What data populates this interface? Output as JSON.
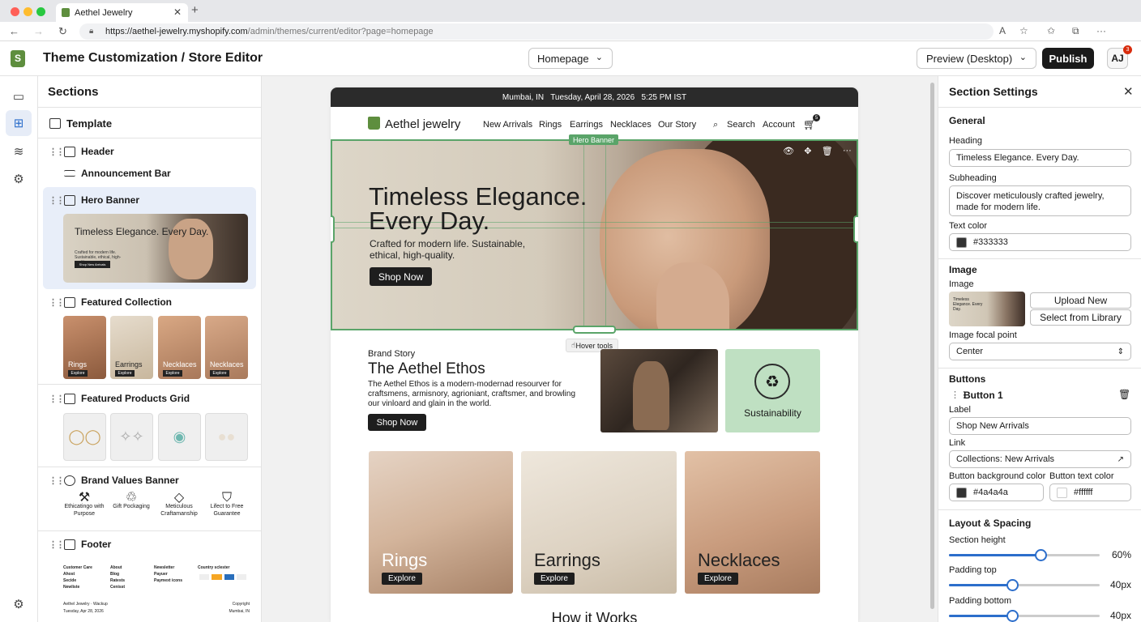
{
  "browser": {
    "tab_title": "Aethel Jewelry",
    "url_host": "https://aethel-jewelry.myshopify.com",
    "url_path": "/admin/themes/current/editor?page=homepage"
  },
  "app": {
    "title": "Theme Customization / Store Editor",
    "page_select": "Homepage",
    "preview_label": "Preview (Desktop)",
    "publish_label": "Publish",
    "avatar": "AJ",
    "notification_count": "3"
  },
  "sections_panel": {
    "heading": "Sections",
    "template_label": "Template",
    "items": [
      {
        "label": "Header"
      },
      {
        "label": "Announcement Bar"
      },
      {
        "label": "Hero Banner"
      },
      {
        "label": "Featured Collection"
      },
      {
        "label": "Featured Products Grid"
      },
      {
        "label": "Brand Values Banner"
      },
      {
        "label": "Footer"
      }
    ],
    "hero_thumb": {
      "title": "Timeless Elegance. Every Day.",
      "sub": "Crafted for modern life. Sustainable, ethical, high-quality.",
      "button": "Shop New Arrivals"
    },
    "featured_collection": [
      {
        "label": "Rings",
        "sub": "Explore"
      },
      {
        "label": "Earrings",
        "sub": "Explore"
      },
      {
        "label": "Necklaces",
        "sub": "Explore"
      },
      {
        "label": "Necklaces",
        "sub": "Explore"
      }
    ],
    "brand_values": [
      {
        "label": "Ethicatingo with Purpose"
      },
      {
        "label": "Gift Pockaging"
      },
      {
        "label": "Meticulous Craftamanship"
      },
      {
        "label": "Lifect to Free Guarantee"
      }
    ],
    "footer_mini": {
      "col1": [
        "Customer Care",
        "Ahost",
        "Secide",
        "Newliste"
      ],
      "col2": [
        "About",
        "Blog",
        "Ratests",
        "Cenisst"
      ],
      "col3": [
        "Newsletter",
        "Payuer",
        "Paymext icons"
      ],
      "country": "Country sclester",
      "bottom_left": "Aethel Jewelry · Wackup",
      "bottom_left_date": "Tuesday, Apr 28, 2026",
      "bottom_right": "Copyright",
      "bottom_right_loc": "Mumbai, IN"
    }
  },
  "store": {
    "topbar": "Mumbai, IN   Tuesday, April 28, 2026   5:25 PM IST",
    "logo": "Aethel jewelry",
    "nav": [
      "New Arrivals",
      "Rings",
      "Earrings",
      "Necklaces",
      "Our Story"
    ],
    "search": "Search",
    "account": "Account",
    "cart_count": "5",
    "hero_tag": "Hero Banner",
    "hero": {
      "heading": "Timeless Elegance. Every Day.",
      "sub": "Crafted for modern life. Sustainable, ethical, high-quality.",
      "button": "Shop Now"
    },
    "hover_tools": "Hover tools",
    "brand": {
      "kicker": "Brand Story",
      "title": "The Aethel Ethos",
      "body": "The Aethel Ethos is a modern-modernad resourver for craftsmens, armisnory, agrioniant, craftsmer, and browling our vinloard and glain in the world.",
      "button": "Shop Now",
      "sustain": "Sustainability"
    },
    "categories": [
      {
        "name": "Rings",
        "cta": "Explore"
      },
      {
        "name": "Earrings",
        "cta": "Explore"
      },
      {
        "name": "Necklaces",
        "cta": "Explore"
      }
    ],
    "how": "How it Works"
  },
  "settings": {
    "heading": "Section Settings",
    "general": "General",
    "heading_label": "Heading",
    "heading_value": "Timeless Elegance. Every Day.",
    "subheading_label": "Subheading",
    "subheading_value": "Discover meticulously crafted jewelry, made for modern life.",
    "text_color_label": "Text color",
    "text_color_value": "#333333",
    "image_group": "Image",
    "image_label": "Image",
    "upload": "Upload New",
    "library": "Select from Library",
    "focal_label": "Image focal point",
    "focal_value": "Center",
    "buttons_group": "Buttons",
    "button1": "Button 1",
    "label_label": "Label",
    "label_value": "Shop New Arrivals",
    "link_label": "Link",
    "link_value": "Collections: New Arrivals",
    "btn_bg_label": "Button background color",
    "btn_bg_value": "#4a4a4a",
    "btn_text_label": "Button text color",
    "btn_text_value": "#ffffff",
    "layout_group": "Layout & Spacing",
    "section_height_label": "Section height",
    "section_height_value": "60%",
    "section_height_level": 0.61,
    "padding_top_label": "Padding top",
    "padding_top_value": "40px",
    "padding_top_level": 0.42,
    "padding_bottom_label": "Padding bottom",
    "padding_bottom_value": "40px",
    "padding_bottom_level": 0.42
  },
  "colors": {
    "accent": "#5aa469",
    "primary_blue": "#2c6ecb",
    "dark": "#1e1e1e",
    "shopify_green": "#5e8e3e"
  }
}
